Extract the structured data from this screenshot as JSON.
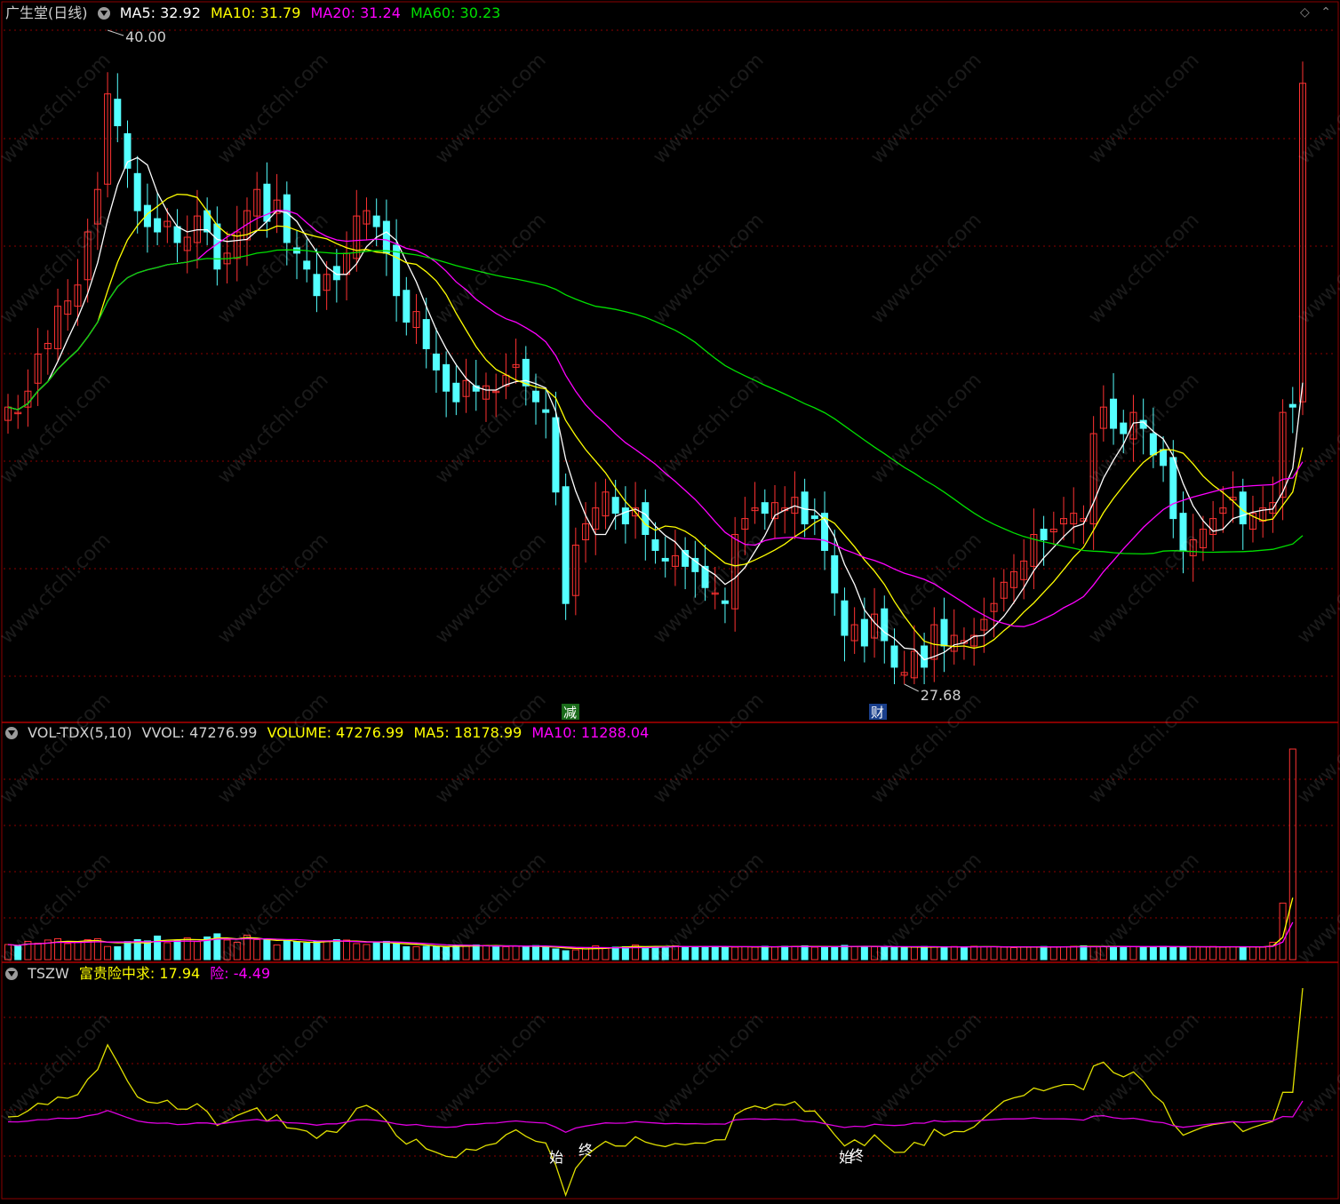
{
  "price_header": {
    "stock_name": "广生堂(日线)",
    "ma5_label": "MA5: 32.92",
    "ma10_label": "MA10: 31.79",
    "ma20_label": "MA20: 31.24",
    "ma60_label": "MA60: 30.23"
  },
  "volume_header": {
    "indicator_name": "VOL-TDX(5,10)",
    "vvol_label": "VVOL: 47276.99",
    "volume_label": "VOLUME: 47276.99",
    "ma5_label": "MA5: 18178.99",
    "ma10_label": "MA10: 11288.04"
  },
  "tszw_header": {
    "indicator_name": "TSZW",
    "line1_label": "富贵险中求: 17.94",
    "line2_label": "险: -4.49"
  },
  "annotations": {
    "high_label": "40.00",
    "low_label": "27.68",
    "tag_jian": "减",
    "tag_cai": "财",
    "marker_start_1": "始",
    "marker_end_1": "终",
    "marker_start_2": "始",
    "marker_end_2": "终"
  },
  "watermark": "www.cfchi.com",
  "colors": {
    "up": "#ff3232",
    "down": "#54ffff",
    "ma5": "#ffffff",
    "ma10": "#ffff00",
    "ma20": "#ff00ff",
    "ma60": "#00e000",
    "grid": "#8b0000"
  },
  "chart_data": [
    {
      "type": "candlestick",
      "title": "广生堂(日线)",
      "ylim": [
        27.68,
        40.0
      ],
      "high": 40.0,
      "low": 27.68,
      "last_ma": {
        "MA5": 32.92,
        "MA10": 31.79,
        "MA20": 31.24,
        "MA60": 30.23
      },
      "closes": [
        32.9,
        32.8,
        33.2,
        33.9,
        34.1,
        34.8,
        34.9,
        35.2,
        36.2,
        37.0,
        38.8,
        38.2,
        37.4,
        36.6,
        36.3,
        36.2,
        36.4,
        36.0,
        36.1,
        36.5,
        36.2,
        35.5,
        35.8,
        36.2,
        36.6,
        37.0,
        36.4,
        36.8,
        36.0,
        35.8,
        35.5,
        35.0,
        35.4,
        35.3,
        35.8,
        36.5,
        36.6,
        36.3,
        35.8,
        35.0,
        34.5,
        34.7,
        34.0,
        33.6,
        33.2,
        33.0,
        33.4,
        33.2,
        33.3,
        33.2,
        33.5,
        33.7,
        33.3,
        33.0,
        32.8,
        31.3,
        29.2,
        30.3,
        30.7,
        31.0,
        31.3,
        30.9,
        30.7,
        31.0,
        30.5,
        30.2,
        30.0,
        30.1,
        29.9,
        29.8,
        29.5,
        29.4,
        29.2,
        30.5,
        30.8,
        31.0,
        30.9,
        31.1,
        31.0,
        31.2,
        30.7,
        30.8,
        30.2,
        29.4,
        28.6,
        28.8,
        28.4,
        29.0,
        28.5,
        28.0,
        27.9,
        28.3,
        28.0,
        28.8,
        28.4,
        28.6,
        28.5,
        28.6,
        28.9,
        29.2,
        29.6,
        29.8,
        30.0,
        30.5,
        30.4,
        30.6,
        30.8,
        30.9,
        30.8,
        32.4,
        32.9,
        32.5,
        32.4,
        32.8,
        32.5,
        32.0,
        31.8,
        30.8,
        30.2,
        30.4,
        30.6,
        30.8,
        31.0,
        31.2,
        30.7,
        30.9,
        31.0,
        31.1,
        32.8,
        32.9,
        39.0
      ],
      "volumes": [
        3400,
        3000,
        4100,
        3700,
        4400,
        4700,
        3600,
        3900,
        4500,
        4700,
        2950,
        2900,
        4050,
        4500,
        4200,
        5300,
        3800,
        4400,
        4900,
        4050,
        5100,
        5800,
        4400,
        3900,
        5500,
        4500,
        4400,
        3300,
        4200,
        4000,
        3700,
        4100,
        4200,
        4500,
        4400,
        3600,
        3400,
        3800,
        4100,
        3600,
        2900,
        2900,
        3000,
        2950,
        2900,
        3200,
        3000,
        3300,
        3200,
        3100,
        2900,
        3000,
        2800,
        3150,
        2800,
        2400,
        2000,
        2200,
        2700,
        3100,
        2700,
        2800,
        2900,
        3300,
        2900,
        2850,
        2950,
        3100,
        2800,
        2900,
        2900,
        3000,
        2900,
        2800,
        2900,
        2800,
        3000,
        2850,
        3000,
        3000,
        3100,
        2800,
        2900,
        2850,
        3200,
        3000,
        3000,
        2900,
        2800,
        2750,
        2900,
        2800,
        2950,
        2800,
        2900,
        2950,
        2800,
        3000,
        2900,
        2900,
        2800,
        2700,
        2900,
        2800,
        2950,
        2800,
        2900,
        3000,
        3100,
        3000,
        2900,
        2850,
        2950,
        2900,
        2850,
        2900,
        3000,
        2800,
        2900,
        2900,
        2850,
        2950,
        2800,
        2900,
        2900,
        2850,
        2800,
        3900,
        12700,
        47276.99
      ],
      "note": "volumes shown as relative bar heights; last bar value 47276.99"
    },
    {
      "type": "line",
      "title": "TSZW",
      "series": [
        {
          "name": "富贵险中求",
          "last": 17.94
        },
        {
          "name": "险",
          "last": -4.49
        }
      ]
    }
  ]
}
